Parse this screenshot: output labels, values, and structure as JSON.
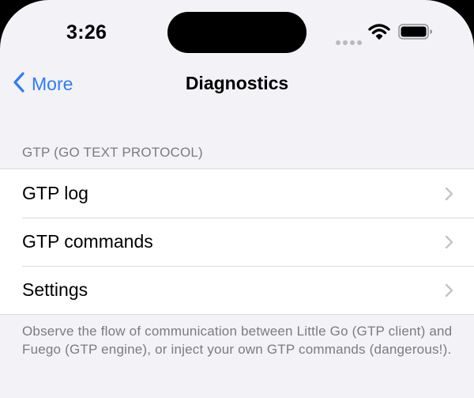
{
  "status_bar": {
    "time": "3:26",
    "icons": [
      "cellular-signal-icon",
      "wifi-icon",
      "battery-icon"
    ]
  },
  "nav": {
    "back_label": "More",
    "title": "Diagnostics"
  },
  "section": {
    "header": "GTP (GO TEXT PROTOCOL)",
    "rows": [
      {
        "label": "GTP log"
      },
      {
        "label": "GTP commands"
      },
      {
        "label": "Settings"
      }
    ],
    "footer": "Observe the flow of communication between Little Go (GTP client) and Fuego (GTP engine), or inject your own GTP commands (dangerous!)."
  },
  "colors": {
    "accent": "#2f7cf6",
    "background": "#f2f2f7",
    "secondary_text": "#7b7b80",
    "chevron": "#c4c4c7"
  }
}
